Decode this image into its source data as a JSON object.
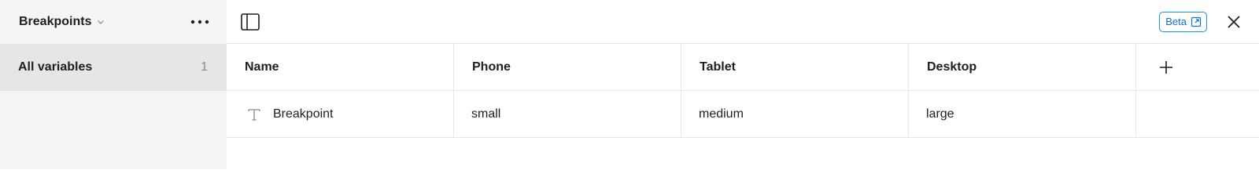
{
  "sidebar": {
    "title": "Breakpoints",
    "collection_dropdown_icon": "chevron-down-icon",
    "more_icon": "more-horizontal-icon",
    "items": [
      {
        "label": "All variables",
        "count": "1",
        "selected": true
      }
    ]
  },
  "topbar": {
    "panel_toggle_icon": "sidebar-toggle-icon",
    "beta_label": "Beta",
    "beta_icon": "external-link-icon",
    "close_icon": "close-icon"
  },
  "table": {
    "columns": [
      "Name",
      "Phone",
      "Tablet",
      "Desktop"
    ],
    "add_column_icon": "plus-icon",
    "rows": [
      {
        "type_icon": "text-type-icon",
        "name": "Breakpoint",
        "values": [
          "small",
          "medium",
          "large"
        ]
      }
    ]
  },
  "colors": {
    "sidebar_bg": "#f5f5f5",
    "selected_item_bg": "#e6e6e6",
    "border": "#e6e6e6",
    "beta_accent": "#0d99ff"
  }
}
